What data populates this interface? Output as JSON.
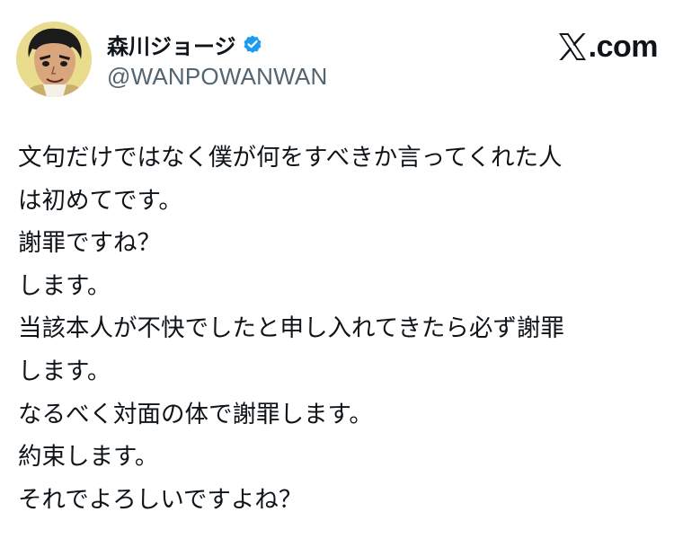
{
  "author": {
    "display_name": "森川ジョージ",
    "handle": "@WANPOWANWAN",
    "verified": true,
    "avatar_icon": "manga-character-avatar"
  },
  "site": {
    "logo_icon": "x-logo-icon",
    "suffix": ".com"
  },
  "colors": {
    "text": "#0f1419",
    "secondary_text": "#536471",
    "verified_badge": "#1d9bf0",
    "background": "#ffffff"
  },
  "post": {
    "lines": [
      "文句だけではなく僕が何をすべきか言ってくれた人",
      "は初めてです。",
      "謝罪ですね？",
      "します。",
      "当該本人が不快でしたと申し入れてきたら必ず謝罪",
      "します。",
      "なるべく対面の体で謝罪します。",
      "約束します。",
      "それでよろしいですよね？"
    ]
  }
}
